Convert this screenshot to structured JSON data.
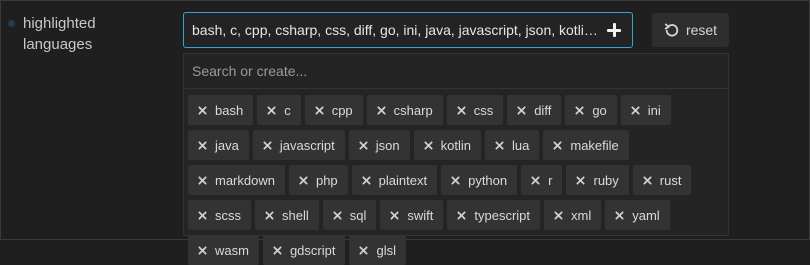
{
  "setting": {
    "label": "highlighted languages"
  },
  "field": {
    "value": "bash, c, cpp, csharp, css, diff, go, ini, java, javascript, json, kotlin, lua, makefile, markdown, php, plaintext, python, r, ruby, rust, scss, shell, sql, swift, typescript, xml, yaml, wasm, gdscript, glsl",
    "add_icon": "plus-icon"
  },
  "reset": {
    "label": "reset",
    "icon": "undo-icon"
  },
  "search": {
    "placeholder": "Search or create..."
  },
  "tags": [
    "bash",
    "c",
    "cpp",
    "csharp",
    "css",
    "diff",
    "go",
    "ini",
    "java",
    "javascript",
    "json",
    "kotlin",
    "lua",
    "makefile",
    "markdown",
    "php",
    "plaintext",
    "python",
    "r",
    "ruby",
    "rust",
    "scss",
    "shell",
    "sql",
    "swift",
    "typescript",
    "xml",
    "yaml",
    "wasm",
    "gdscript",
    "glsl"
  ],
  "colors": {
    "background": "#1f1f1f",
    "accent_border": "#3aa0d8",
    "tag_background": "#333333",
    "text": "#dadada"
  }
}
